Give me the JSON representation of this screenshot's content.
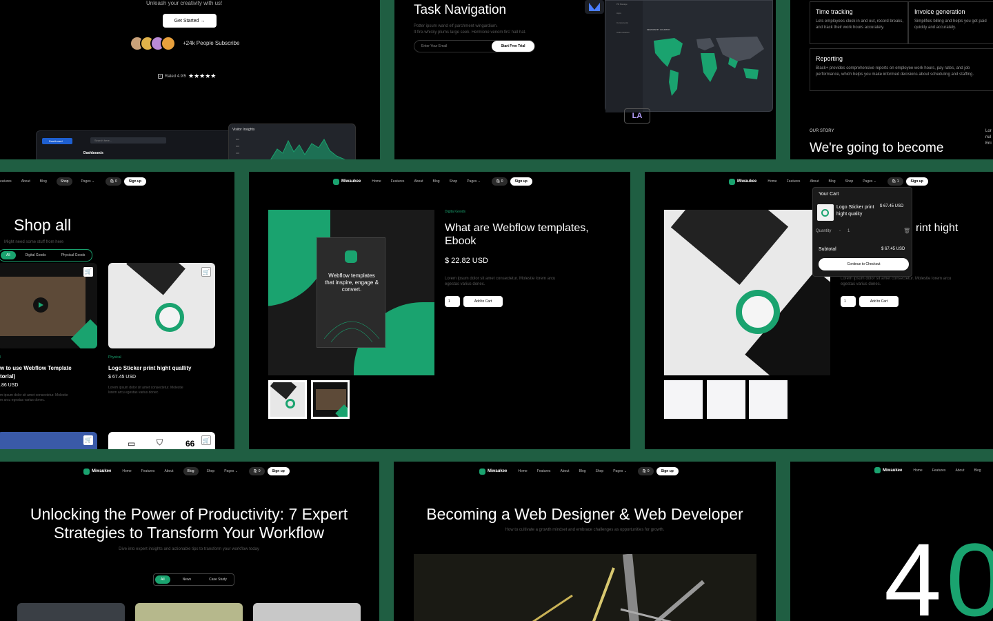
{
  "hero1": {
    "tagline": "Unleash your creativity with us!",
    "cta": "Get Started →",
    "subscribers": "+24k People Subscribe",
    "rating": "Rated 4.9/5",
    "dash_item": "Dashboard",
    "dash_title": "Dashboards",
    "search_placeholder": "Search here...",
    "visitor_title": "Visitor Insights",
    "visitor_ticks": [
      "800",
      "600",
      "400"
    ]
  },
  "task": {
    "title": "Task Navigation",
    "desc1": "Potter ipsum wand elf parchment wingardium.",
    "desc2": "It fire-whisky plums large seek. Hermione venom firs' hall hat.",
    "email_placeholder": "Enter Your Email",
    "cta": "Start Free Trial",
    "map_title": "SESSION BY COUNTRY",
    "sidebar": [
      "Pill Manage",
      "Apps",
      "Components",
      "Authentication"
    ],
    "logo_text": "LA"
  },
  "features": {
    "items": [
      {
        "title": "Time tracking",
        "desc": "Lets employees clock in and out, record breaks, and track their work hours accurately."
      },
      {
        "title": "Invoice generation",
        "desc": "Simplifies billing and helps you get paid quickly and accurately."
      },
      {
        "title": "Reporting",
        "desc": "Black+ provides comprehensive reports on employee work hours, pay rates, and job performance, which helps you make informed decisions about scheduling and staffing."
      }
    ],
    "story_label": "OUR STORY",
    "story_title": "We're going to become",
    "side_text": [
      "Lor",
      "nul",
      "Eni"
    ]
  },
  "nav": {
    "logo": "Miwaukee",
    "links": [
      "Home",
      "Features",
      "About",
      "Blog",
      "Shop",
      "Pages"
    ],
    "cart": "0",
    "cart_one": "1",
    "signup": "Sign up"
  },
  "shop": {
    "links": [
      "eatures",
      "About",
      "Blog",
      "Shop",
      "Pages"
    ],
    "title": "Shop all",
    "subtitle": "Might need some stuff from here",
    "filters": [
      "All",
      "Digital Goods",
      "Physical Goods"
    ],
    "card1": {
      "cat": "l",
      "title": "w to use Webflow Template",
      "title2": "torial)",
      "price": ".86 USD",
      "desc": "m ipsum dolor sit amet consectetur. Molestie",
      "desc2": "m arcu egestas varius donec."
    },
    "card2": {
      "cat": "Physical",
      "title": "Logo Sticker print hight quallity",
      "price": "$ 67.45 USD",
      "desc": "Lorem ipsum dolor sit amet consectetur. Molestie",
      "desc2": "lorem arcu egestas varius donec."
    },
    "icon_number": "66"
  },
  "product": {
    "category": "Digital Goods",
    "title1": "What are Webflow templates,",
    "title2": "Ebook",
    "price": "$ 22.82 USD",
    "desc1": "Lorem ipsum dolor sit amet consectetur. Molestie lorem arcu",
    "desc2": "egestas varius donec.",
    "qty": "1",
    "add": "Add to Cart",
    "book_text": "Webflow templates that inspire, engage & convert."
  },
  "cartpanel": {
    "title": "Your Cart",
    "item": "Logo Sticker print hight quality",
    "item_price": "$ 67.45 USD",
    "qty_label": "Quantity",
    "qty_minus": "-",
    "qty": "1",
    "subtotal_label": "Subtotal",
    "subtotal": "$ 67.45 USD",
    "checkout": "Continue to Checkout",
    "peek_title": "rint hight",
    "desc1": "Lorem ipsum dolor sit amet consectetur. Molestie lorem arcu",
    "desc2": "egestas varius donec.",
    "qty_field": "1",
    "add": "Add to Cart"
  },
  "blog1": {
    "links": [
      "Home",
      "Features",
      "About",
      "Blog",
      "Shop",
      "Pages"
    ],
    "title1": "Unlocking the Power of Productivity: 7 Expert",
    "title2": "Strategies to Transform Your Workflow",
    "subtitle": "Dive into expert insights and actionable tips to transform your workflow today",
    "tabs": [
      "All",
      "News",
      "Case Study"
    ]
  },
  "blog2": {
    "title": "Becoming a Web Designer & Web Developer",
    "subtitle": "How to cultivate a growth mindset and embrace challenges as opportunities for growth."
  },
  "error": {
    "links": [
      "Home",
      "Features",
      "About",
      "Blog"
    ],
    "d1": "4",
    "d2": "0"
  },
  "colors": {
    "accent": "#1aa36f",
    "frame": "#1f5e42",
    "bg": "#000000"
  }
}
